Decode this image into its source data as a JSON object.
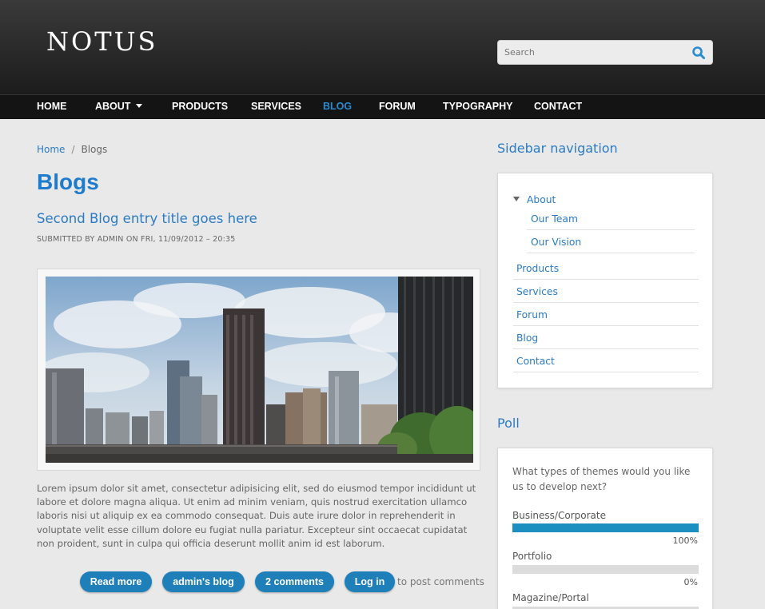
{
  "header": {
    "logo": "NOTUS",
    "search_placeholder": "Search"
  },
  "nav": {
    "items": [
      {
        "label": "HOME"
      },
      {
        "label": "ABOUT"
      },
      {
        "label": "PRODUCTS"
      },
      {
        "label": "SERVICES"
      },
      {
        "label": "BLOG",
        "active": true
      },
      {
        "label": "FORUM"
      },
      {
        "label": "TYPOGRAPHY"
      },
      {
        "label": "CONTACT"
      }
    ]
  },
  "breadcrumb": {
    "home": "Home",
    "separator": "/",
    "current": "Blogs"
  },
  "main": {
    "page_title": "Blogs",
    "entry_title": "Second Blog entry title goes here",
    "submitted": "SUBMITTED BY ADMIN ON FRI, 11/09/2012 – 20:35",
    "body": "Lorem ipsum dolor sit amet, consectetur adipisicing elit, sed do eiusmod tempor incididunt ut labore et dolore magna aliqua. Ut enim ad minim veniam, quis nostrud exercitation ullamco laboris nisi ut aliquip ex ea commodo consequat. Duis aute irure dolor in reprehenderit in voluptate velit esse cillum dolore eu fugiat nulla pariatur. Excepteur sint occaecat cupidatat non proident, sunt in culpa qui officia deserunt mollit anim id est laborum.",
    "links": {
      "read_more": "Read more",
      "admins_blog": "admin's blog",
      "comments": "2 comments",
      "log_in": "Log in",
      "to_post": "to post comments"
    }
  },
  "sidebar": {
    "nav_title": "Sidebar navigation",
    "menu": {
      "about": "About",
      "our_team": "Our Team",
      "our_vision": "Our Vision",
      "products": "Products",
      "services": "Services",
      "forum": "Forum",
      "blog": "Blog",
      "contact": "Contact"
    },
    "poll_title": "Poll",
    "poll": {
      "question": "What types of themes would you like us to develop next?",
      "choices": [
        {
          "label": "Business/Corporate",
          "percent": "100%",
          "value": 1.0
        },
        {
          "label": "Portfolio",
          "percent": "0%",
          "value": 0.0
        },
        {
          "label": "Magazine/Portal",
          "percent": "",
          "value": 0.0
        }
      ]
    }
  },
  "colors": {
    "accent": "#2b7bc4",
    "button": "#1f7fb8",
    "poll_bar": "#1b8fc0"
  }
}
